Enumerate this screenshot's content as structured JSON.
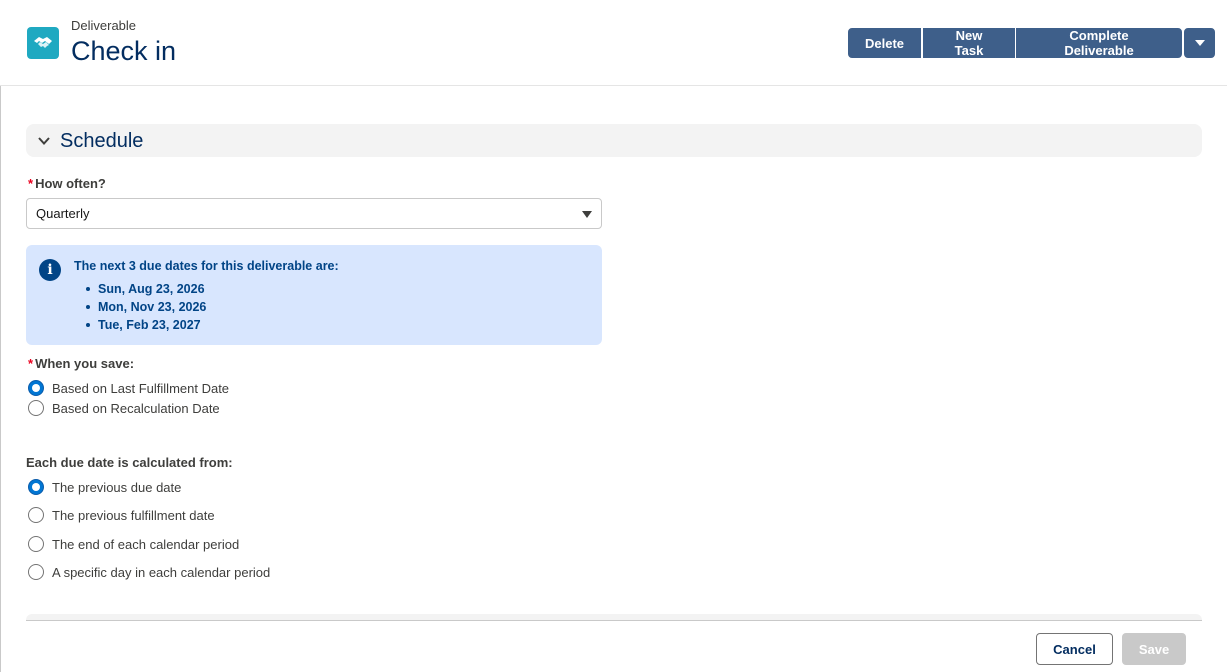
{
  "header": {
    "object_type": "Deliverable",
    "title": "Check in",
    "icon": "handshake-icon",
    "actions": {
      "delete": "Delete",
      "new_task": "New Task",
      "complete": "Complete Deliverable",
      "more": "chevron-down-icon"
    }
  },
  "section": {
    "title": "Schedule",
    "expanded": true
  },
  "how_often": {
    "required": "*",
    "label": "How often?",
    "value": "Quarterly"
  },
  "info": {
    "heading": "The next 3 due dates for this deliverable are:",
    "dates": [
      "Sun, Aug 23, 2026",
      "Mon, Nov 23, 2026",
      "Tue, Feb 23, 2027"
    ]
  },
  "when_save": {
    "required": "*",
    "label": "When you save:",
    "options": [
      {
        "label": "Based on Last Fulfillment Date",
        "checked": true
      },
      {
        "label": "Based on Recalculation Date",
        "checked": false
      }
    ]
  },
  "calc_from": {
    "label": "Each due date is calculated from:",
    "options": [
      {
        "label": "The previous due date",
        "checked": true
      },
      {
        "label": "The previous fulfillment date",
        "checked": false
      },
      {
        "label": "The end of each calendar period",
        "checked": false
      },
      {
        "label": "A specific day in each calendar period",
        "checked": false
      }
    ]
  },
  "footer": {
    "cancel": "Cancel",
    "save": "Save"
  },
  "colors": {
    "brand_button": "#3e5f8a",
    "title_navy": "#032d60",
    "info_bg": "#d8e6fe",
    "radio_selected": "#0176d3",
    "required": "#ea001e",
    "icon_bg": "#1fa9c1"
  }
}
